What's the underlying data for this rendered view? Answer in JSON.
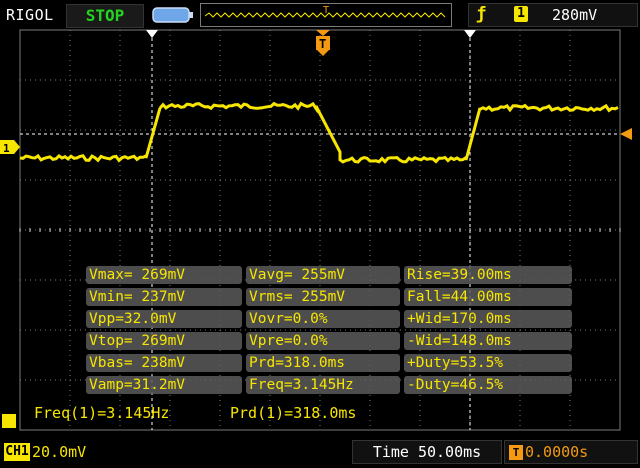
{
  "header": {
    "brand": "RIGOL",
    "run_state": "STOP",
    "trigger_source": "1",
    "trigger_level": "280mV"
  },
  "colors": {
    "channel1": "#f7e600",
    "trigger": "#f39a12",
    "stop_green": "#23d421",
    "grid": "#7a7a7a",
    "meas_bg": "#5a5a5a"
  },
  "measurements": [
    [
      "Vmax= 269mV",
      "Vavg= 255mV",
      "Rise=39.00ms"
    ],
    [
      "Vmin= 237mV",
      "Vrms= 255mV",
      "Fall=44.00ms"
    ],
    [
      "Vpp=32.0mV",
      "Vovr=0.0%",
      "+Wid=170.0ms"
    ],
    [
      "Vtop= 269mV",
      "Vpre=0.0%",
      "-Wid=148.0ms"
    ],
    [
      "Vbas= 238mV",
      "Prd=318.0ms",
      "+Duty=53.5%"
    ],
    [
      "Vamp=31.2mV",
      "Freq=3.145Hz",
      "-Duty=46.5%"
    ]
  ],
  "freq_readout": "Freq(1)=3.145Hz",
  "period_readout": "Prd(1)=318.0ms",
  "footer": {
    "channel_label": "CH1",
    "channel_scale": "20.0mV",
    "timebase": "Time 50.00ms",
    "trigger_delay": "0.0000s"
  }
}
